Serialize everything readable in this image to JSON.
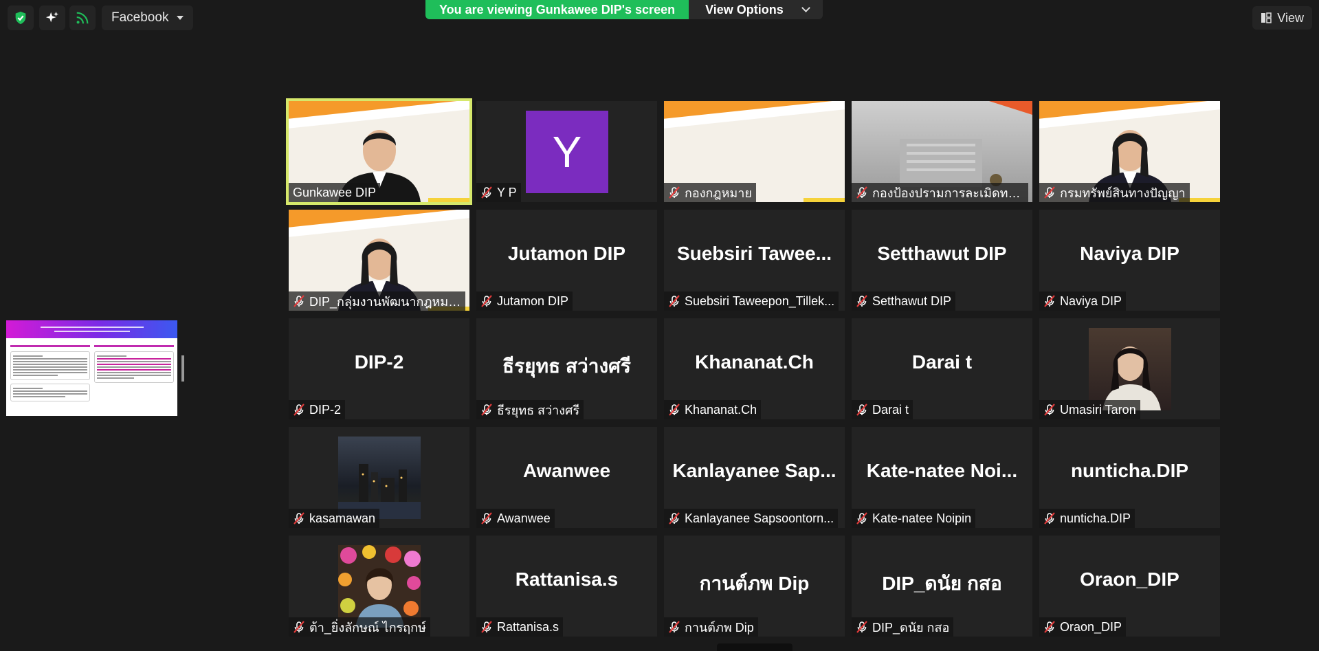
{
  "toolbar": {
    "security_icon": "shield-check-icon",
    "ai_icon": "sparkle-icon",
    "stream_icon": "live-stream-icon",
    "stream_target": "Facebook"
  },
  "banner": {
    "viewing_text": "You are viewing Gunkawee DIP's screen",
    "view_options_label": "View Options"
  },
  "view_button": {
    "label": "View"
  },
  "colors": {
    "banner_green": "#1fbe5a",
    "active_speaker": "#d6e86b",
    "mute_red": "#e03b3b",
    "tile_bg": "#232323"
  },
  "gallery": {
    "tiles": [
      {
        "label": "Gunkawee DIP",
        "big": "",
        "muted": false,
        "active": true,
        "media": "video-slide-man"
      },
      {
        "label": "Y P",
        "big": "",
        "muted": true,
        "active": false,
        "media": "avatar-letter",
        "avatar_letter": "Y"
      },
      {
        "label": "กองกฎหมาย",
        "big": "",
        "muted": true,
        "active": false,
        "media": "video-slide-empty"
      },
      {
        "label": "กองป้องปรามการละเมิดทรัพย์...",
        "big": "",
        "muted": true,
        "active": false,
        "media": "video-building"
      },
      {
        "label": "กรมทรัพย์สินทางปัญญา",
        "big": "",
        "muted": true,
        "active": false,
        "media": "video-slide-woman"
      },
      {
        "label": "DIP_กลุ่มงานพัฒนากฎหมาย",
        "big": "",
        "muted": true,
        "active": false,
        "media": "video-slide-woman2"
      },
      {
        "label": "Jutamon DIP",
        "big": "Jutamon DIP",
        "muted": true,
        "active": false,
        "media": "name"
      },
      {
        "label": "Suebsiri Taweepon_Tillek...",
        "big": "Suebsiri  Tawee...",
        "muted": true,
        "active": false,
        "media": "name"
      },
      {
        "label": "Setthawut DIP",
        "big": "Setthawut DIP",
        "muted": true,
        "active": false,
        "media": "name"
      },
      {
        "label": "Naviya DIP",
        "big": "Naviya DIP",
        "muted": true,
        "active": false,
        "media": "name"
      },
      {
        "label": "DIP-2",
        "big": "DIP-2",
        "muted": true,
        "active": false,
        "media": "name"
      },
      {
        "label": "ธีรยุทธ สว่างศรี",
        "big": "ธีรยุทธ สว่างศรี",
        "muted": true,
        "active": false,
        "media": "name"
      },
      {
        "label": "Khananat.Ch",
        "big": "Khananat.Ch",
        "muted": true,
        "active": false,
        "media": "name"
      },
      {
        "label": "Darai t",
        "big": "Darai t",
        "muted": true,
        "active": false,
        "media": "name"
      },
      {
        "label": "Umasiri Taron",
        "big": "",
        "muted": true,
        "active": false,
        "media": "profile-photo-woman"
      },
      {
        "label": "kasamawan",
        "big": "",
        "muted": true,
        "active": false,
        "media": "profile-photo-city"
      },
      {
        "label": "Awanwee",
        "big": "Awanwee",
        "muted": true,
        "active": false,
        "media": "name"
      },
      {
        "label": "Kanlayanee Sapsoontorn...",
        "big": "Kanlayanee  Sap...",
        "muted": true,
        "active": false,
        "media": "name"
      },
      {
        "label": "Kate-natee Noipin",
        "big": "Kate-natee  Noi...",
        "muted": true,
        "active": false,
        "media": "name"
      },
      {
        "label": "nunticha.DIP",
        "big": "nunticha.DIP",
        "muted": true,
        "active": false,
        "media": "name"
      },
      {
        "label": "ต้า_ยิ่งลักษณ์ ไกรฤกษ์",
        "big": "",
        "muted": true,
        "active": false,
        "media": "profile-photo-flowers"
      },
      {
        "label": "Rattanisa.s",
        "big": "Rattanisa.s",
        "muted": true,
        "active": false,
        "media": "name"
      },
      {
        "label": "กานต์ภพ Dip",
        "big": "กานต์ภพ Dip",
        "muted": true,
        "active": false,
        "media": "name"
      },
      {
        "label": "DIP_ดนัย กสอ",
        "big": "DIP_ดนัย กสอ",
        "muted": true,
        "active": false,
        "media": "name"
      },
      {
        "label": "Oraon_DIP",
        "big": "Oraon_DIP",
        "muted": true,
        "active": false,
        "media": "name"
      }
    ]
  }
}
